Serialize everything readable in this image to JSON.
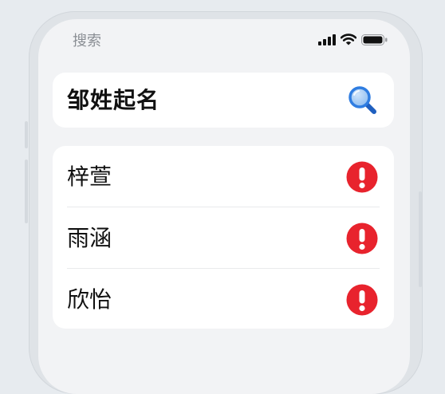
{
  "status_bar": {
    "back_label": "搜索",
    "icons": [
      "cellular-signal-icon",
      "wifi-icon",
      "battery-icon"
    ]
  },
  "search": {
    "query": "邹姓起名",
    "icon": "magnifier-icon",
    "accent_color": "#2f7de1"
  },
  "results": {
    "items": [
      {
        "label": "梓萱",
        "status_icon": "exclamation-alert-icon"
      },
      {
        "label": "雨涵",
        "status_icon": "exclamation-alert-icon"
      },
      {
        "label": "欣怡",
        "status_icon": "exclamation-alert-icon"
      }
    ],
    "alert_color": "#e8232d"
  }
}
